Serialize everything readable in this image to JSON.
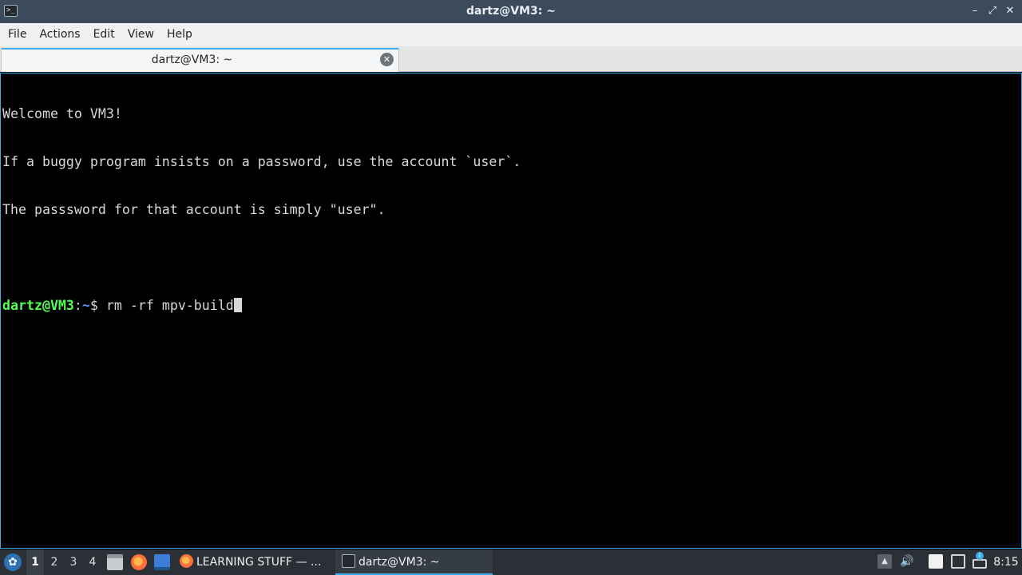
{
  "window": {
    "title": "dartz@VM3: ~"
  },
  "menubar": {
    "items": [
      "File",
      "Actions",
      "Edit",
      "View",
      "Help"
    ]
  },
  "tabs": [
    {
      "label": "dartz@VM3: ~"
    }
  ],
  "terminal": {
    "lines": [
      "Welcome to VM3!",
      "If a buggy program insists on a password, use the account `user`.",
      "The passsword for that account is simply \"user\"."
    ],
    "prompt_user": "dartz@VM3",
    "prompt_sep": ":",
    "prompt_path": "~",
    "prompt_symbol": "$ ",
    "command": "rm -rf mpv-build"
  },
  "taskbar": {
    "workspaces": [
      "1",
      "2",
      "3",
      "4"
    ],
    "active_workspace": "1",
    "tasks": [
      {
        "label": "LEARNING STUFF — ...",
        "icon": "firefox-icon"
      },
      {
        "label": "dartz@VM3: ~",
        "icon": "terminal-icon"
      }
    ],
    "clock": "8:15"
  },
  "colors": {
    "accent": "#3daee9",
    "prompt_user": "#54ff54",
    "prompt_path": "#5c8cff",
    "titlebar": "#3c4b5c",
    "taskbar": "#2b3037"
  }
}
